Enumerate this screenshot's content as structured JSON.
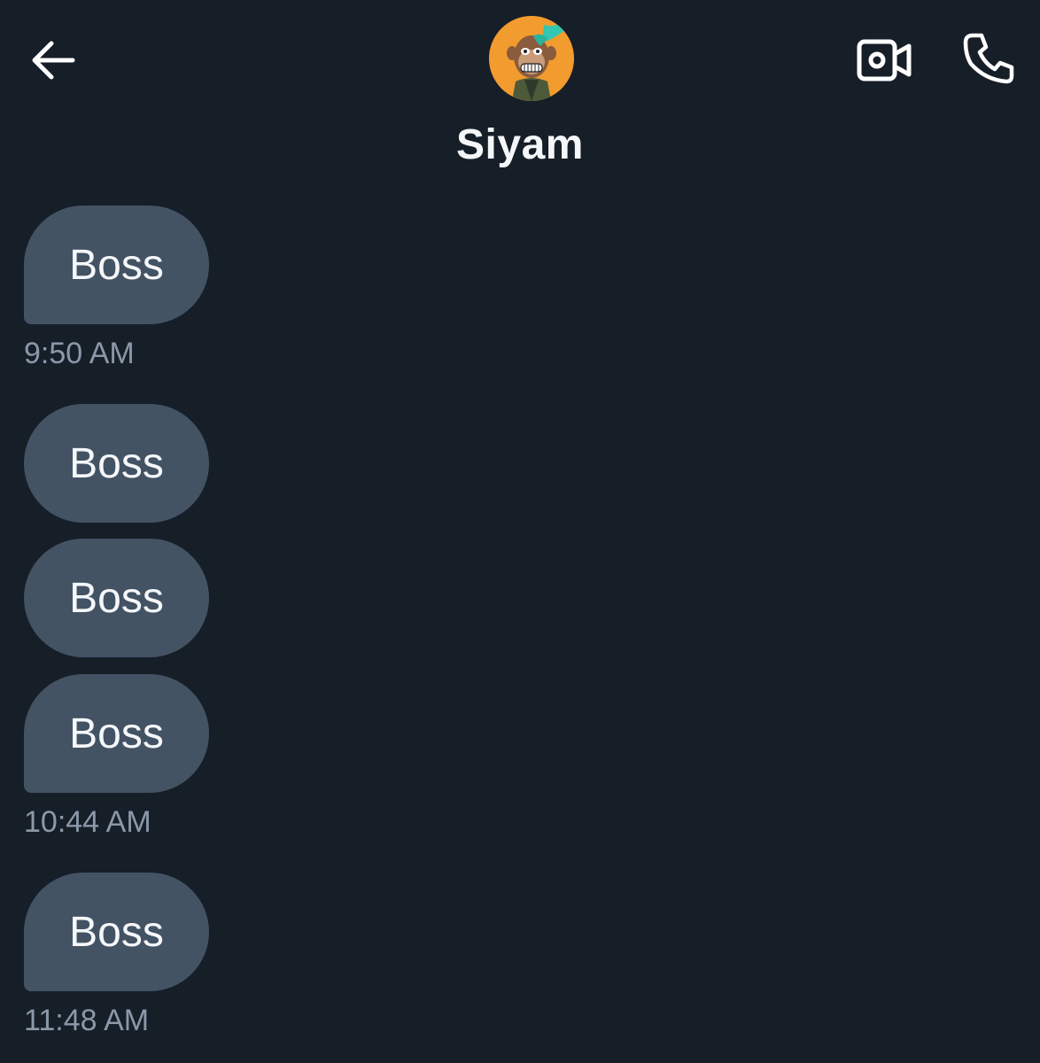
{
  "header": {
    "back_icon": "arrow-left-icon",
    "contact_name": "Siyam",
    "avatar_icon": "ape-avatar",
    "video_call_icon": "video-camera-icon",
    "voice_call_icon": "phone-icon"
  },
  "messages": [
    {
      "text": "Boss",
      "time": "9:50 AM"
    },
    {
      "text": "Boss"
    },
    {
      "text": "Boss"
    },
    {
      "text": "Boss",
      "time": "10:44 AM"
    },
    {
      "text": "Boss",
      "time": "11:48 AM"
    }
  ],
  "colors": {
    "background": "#161e28",
    "bubble": "#435364",
    "timestamp": "#8a98a8",
    "avatar_bg": "#f29b2e"
  }
}
